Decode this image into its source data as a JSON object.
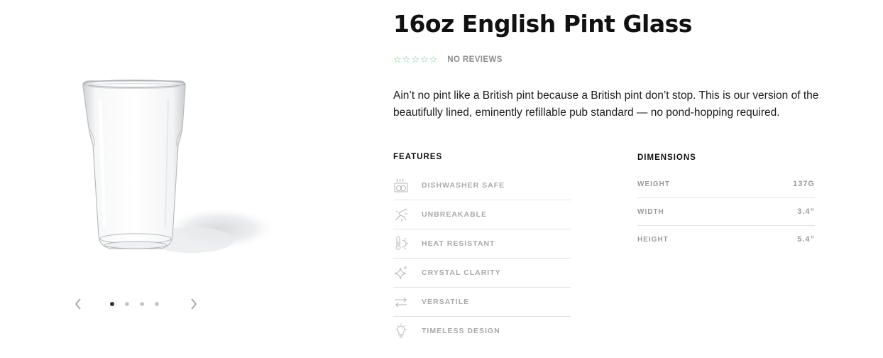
{
  "product": {
    "title": "16oz English Pint Glass",
    "rating": {
      "stars_filled": 0,
      "stars_total": 5,
      "star_color": "#7ec98f",
      "reviews_label": "NO REVIEWS"
    },
    "description": "Ain’t no pint like a British pint because a British pint don’t stop. This is our version of the beautifully lined, eminently refillable pub standard — no pond-hopping required."
  },
  "gallery": {
    "image_name": "pint-glass-image",
    "prev_icon": "chevron-left-icon",
    "next_icon": "chevron-right-icon",
    "slide_count": 4,
    "active_slide": 1
  },
  "features": {
    "heading": "FEATURES",
    "items": [
      {
        "label": "DISHWASHER SAFE",
        "icon": "dishwasher-icon"
      },
      {
        "label": "UNBREAKABLE",
        "icon": "shatter-icon"
      },
      {
        "label": "HEAT RESISTANT",
        "icon": "thermometer-icon"
      },
      {
        "label": "CRYSTAL CLARITY",
        "icon": "sparkle-icon"
      },
      {
        "label": "VERSATILE",
        "icon": "arrows-icon"
      },
      {
        "label": "TIMELESS DESIGN",
        "icon": "lightbulb-icon"
      }
    ]
  },
  "dimensions": {
    "heading": "DIMENSIONS",
    "rows": [
      {
        "label": "WEIGHT",
        "value": "137G"
      },
      {
        "label": "WIDTH",
        "value": "3.4”"
      },
      {
        "label": "HEIGHT",
        "value": "5.4”"
      }
    ]
  }
}
